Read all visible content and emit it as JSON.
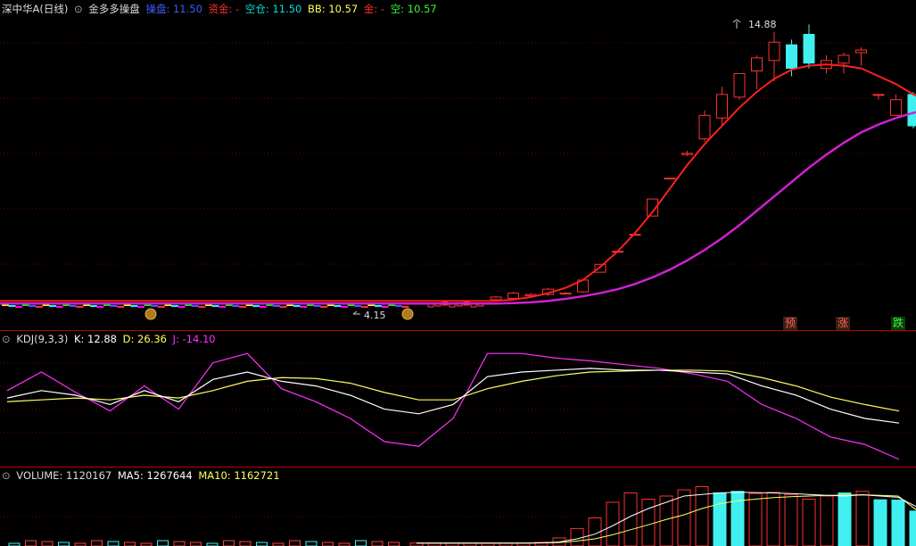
{
  "main": {
    "stock_name": "深中华A(日线)",
    "indicator_name": "金多多操盘",
    "legend": [
      {
        "label": "操盘: 11.50",
        "color": "#3d5bff"
      },
      {
        "label": "资金: -",
        "color": "#ff3030"
      },
      {
        "label": "空仓: 11.50",
        "color": "#00e0e0"
      },
      {
        "label": "BB: 10.57",
        "color": "#ffff60"
      },
      {
        "label": "金: -",
        "color": "#ff3030"
      },
      {
        "label": "空: 10.57",
        "color": "#30ff30"
      }
    ],
    "high_label": "14.88",
    "low_label": "4.15",
    "signals": [
      {
        "text": "预",
        "color": "#ff6060"
      },
      {
        "text": "涨",
        "color": "#ff6060"
      },
      {
        "text": "跌",
        "color": "#30ff30"
      }
    ]
  },
  "kdj": {
    "title": "KDJ(9,3,3)",
    "k_label": "K: 12.88",
    "d_label": "D: 26.36",
    "j_label": "J: -14.10",
    "colors": {
      "k": "#ffffff",
      "d": "#ffff60",
      "j": "#ff30ff"
    }
  },
  "volume": {
    "title": "VOLUME: 1120167",
    "ma5_label": "MA5: 1267644",
    "ma10_label": "MA10: 1162721",
    "colors": {
      "ma5": "#ffffff",
      "ma10": "#ffff60"
    }
  },
  "chart_data": {
    "type": "line",
    "candles_recent": [
      {
        "o": 4.35,
        "c": 4.45,
        "h": 4.5,
        "l": 4.3
      },
      {
        "o": 4.4,
        "c": 4.6,
        "h": 4.65,
        "l": 4.35
      },
      {
        "o": 4.5,
        "c": 4.55,
        "h": 4.6,
        "l": 4.45
      },
      {
        "o": 4.55,
        "c": 4.75,
        "h": 4.8,
        "l": 4.5
      },
      {
        "o": 4.6,
        "c": 4.6,
        "h": 4.65,
        "l": 4.55
      },
      {
        "o": 4.65,
        "c": 5.1,
        "h": 5.1,
        "l": 4.6
      },
      {
        "o": 5.4,
        "c": 5.7,
        "h": 5.7,
        "l": 5.4
      },
      {
        "o": 6.2,
        "c": 6.2,
        "h": 6.2,
        "l": 6.2
      },
      {
        "o": 6.85,
        "c": 6.85,
        "h": 6.85,
        "l": 6.85
      },
      {
        "o": 7.55,
        "c": 8.2,
        "h": 8.2,
        "l": 7.55
      },
      {
        "o": 9.0,
        "c": 9.0,
        "h": 9.0,
        "l": 9.0
      },
      {
        "o": 9.9,
        "c": 9.95,
        "h": 10.05,
        "l": 9.85
      },
      {
        "o": 10.5,
        "c": 11.4,
        "h": 11.6,
        "l": 10.4
      },
      {
        "o": 11.3,
        "c": 12.2,
        "h": 12.5,
        "l": 11.0
      },
      {
        "o": 12.1,
        "c": 13.0,
        "h": 13.0,
        "l": 12.0
      },
      {
        "o": 13.1,
        "c": 13.6,
        "h": 13.7,
        "l": 12.4
      },
      {
        "o": 13.5,
        "c": 14.2,
        "h": 14.6,
        "l": 12.7
      },
      {
        "o": 14.1,
        "c": 13.2,
        "h": 14.3,
        "l": 12.9
      },
      {
        "o": 14.5,
        "c": 13.4,
        "h": 14.88,
        "l": 13.2
      },
      {
        "o": 13.2,
        "c": 13.5,
        "h": 13.7,
        "l": 13.0
      },
      {
        "o": 13.4,
        "c": 13.7,
        "h": 13.8,
        "l": 13.0
      },
      {
        "o": 13.8,
        "c": 13.9,
        "h": 14.0,
        "l": 13.3
      },
      {
        "o": 12.2,
        "c": 12.2,
        "h": 12.2,
        "l": 12.0
      },
      {
        "o": 11.4,
        "c": 12.0,
        "h": 12.2,
        "l": 11.4
      },
      {
        "o": 12.2,
        "c": 11.0,
        "h": 12.3,
        "l": 10.9
      },
      {
        "o": 11.2,
        "c": 12.0,
        "h": 12.2,
        "l": 11.0
      },
      {
        "o": 12.2,
        "c": 11.3,
        "h": 12.4,
        "l": 11.2
      },
      {
        "o": 11.9,
        "c": 11.3,
        "h": 12.0,
        "l": 11.2
      },
      {
        "o": 10.9,
        "c": 10.3,
        "h": 11.0,
        "l": 10.2
      }
    ],
    "red_line": [
      4.3,
      4.35,
      4.45,
      4.6,
      4.8,
      5.1,
      5.6,
      6.2,
      6.9,
      7.7,
      8.6,
      9.5,
      10.3,
      11.0,
      11.7,
      12.3,
      12.8,
      13.15,
      13.3,
      13.35,
      13.3,
      13.2,
      12.9,
      12.6,
      12.2,
      11.9,
      11.7,
      11.5,
      11.2
    ],
    "magenta_line": [
      4.2,
      4.22,
      4.25,
      4.3,
      4.38,
      4.48,
      4.6,
      4.75,
      4.95,
      5.2,
      5.5,
      5.85,
      6.25,
      6.7,
      7.2,
      7.75,
      8.3,
      8.85,
      9.4,
      9.9,
      10.35,
      10.75,
      11.05,
      11.3,
      11.5,
      11.65,
      11.8,
      11.9,
      12.0
    ],
    "kdj_k": [
      52,
      60,
      55,
      45,
      60,
      48,
      72,
      80,
      70,
      65,
      55,
      40,
      35,
      45,
      75,
      80,
      82,
      84,
      82,
      82,
      80,
      78,
      65,
      55,
      40,
      30,
      25
    ],
    "kdj_d": [
      48,
      50,
      52,
      50,
      55,
      52,
      60,
      70,
      74,
      73,
      68,
      58,
      50,
      50,
      62,
      70,
      76,
      80,
      81,
      82,
      82,
      81,
      74,
      65,
      53,
      45,
      38
    ],
    "kdj_j": [
      60,
      80,
      58,
      38,
      65,
      40,
      90,
      100,
      62,
      48,
      30,
      5,
      0,
      30,
      100,
      100,
      95,
      92,
      88,
      84,
      78,
      70,
      45,
      30,
      10,
      2,
      -14.1
    ],
    "volume": [
      95000,
      91000,
      93000,
      92000,
      94000,
      92000,
      95000,
      120000,
      260000,
      560000,
      900000,
      1400000,
      1700000,
      1500000,
      1600000,
      1800000,
      1900000,
      1700000,
      1750000,
      1680000,
      1720000,
      1650000,
      1500000,
      1600000,
      1700000,
      1750000,
      1480000,
      1470000,
      1120167
    ],
    "vol_ma5": [
      92000,
      92000,
      93000,
      93000,
      93000,
      93000,
      93000,
      100000,
      130000,
      230000,
      380000,
      650000,
      950000,
      1200000,
      1400000,
      1600000,
      1650000,
      1700000,
      1720000,
      1710000,
      1700000,
      1680000,
      1650000,
      1620000,
      1600000,
      1640000,
      1600000,
      1560000,
      1267644
    ],
    "vol_ma10": [
      92000,
      92000,
      92000,
      92000,
      92000,
      93000,
      93000,
      96000,
      110000,
      160000,
      230000,
      360000,
      520000,
      680000,
      850000,
      1000000,
      1200000,
      1350000,
      1450000,
      1500000,
      1550000,
      1580000,
      1600000,
      1620000,
      1630000,
      1640000,
      1620000,
      1600000,
      1162721
    ]
  }
}
